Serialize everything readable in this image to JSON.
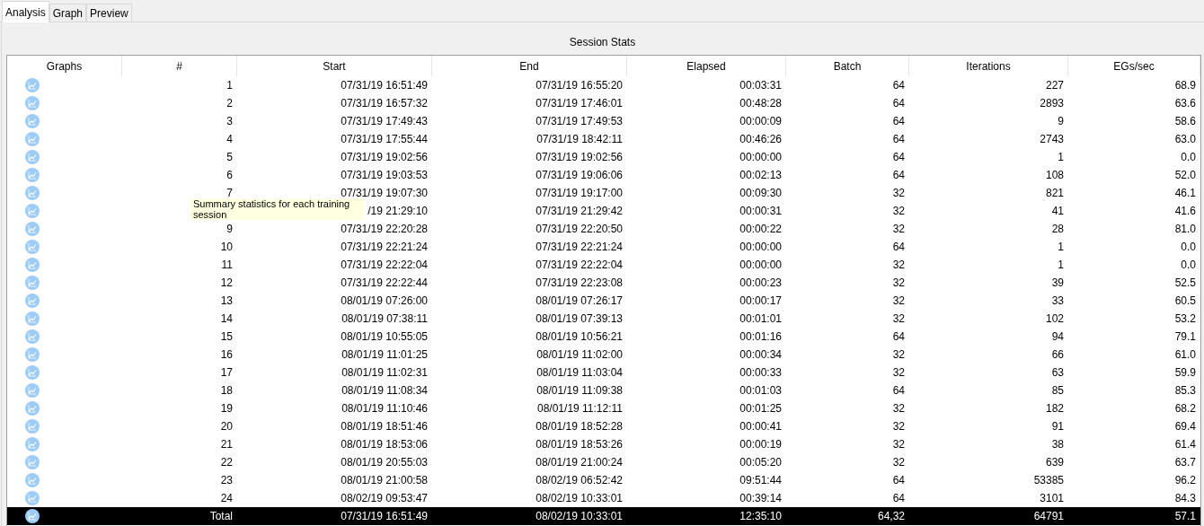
{
  "tabs": [
    {
      "label": "Analysis",
      "selected": true
    },
    {
      "label": "Graph",
      "selected": false
    },
    {
      "label": "Preview",
      "selected": false
    }
  ],
  "panel_title": "Session Stats",
  "columns": [
    "Graphs",
    "#",
    "Start",
    "End",
    "Elapsed",
    "Batch",
    "Iterations",
    "EGs/sec"
  ],
  "rows": [
    {
      "num": "1",
      "start": "07/31/19 16:51:49",
      "end": "07/31/19 16:55:20",
      "elapsed": "00:03:31",
      "batch": "64",
      "iterations": "227",
      "egs": "68.9",
      "selected": false
    },
    {
      "num": "2",
      "start": "07/31/19 16:57:32",
      "end": "07/31/19 17:46:01",
      "elapsed": "00:48:28",
      "batch": "64",
      "iterations": "2893",
      "egs": "63.6",
      "selected": false
    },
    {
      "num": "3",
      "start": "07/31/19 17:49:43",
      "end": "07/31/19 17:49:53",
      "elapsed": "00:00:09",
      "batch": "64",
      "iterations": "9",
      "egs": "58.6",
      "selected": false
    },
    {
      "num": "4",
      "start": "07/31/19 17:55:44",
      "end": "07/31/19 18:42:11",
      "elapsed": "00:46:26",
      "batch": "64",
      "iterations": "2743",
      "egs": "63.0",
      "selected": false
    },
    {
      "num": "5",
      "start": "07/31/19 19:02:56",
      "end": "07/31/19 19:02:56",
      "elapsed": "00:00:00",
      "batch": "64",
      "iterations": "1",
      "egs": "0.0",
      "selected": false
    },
    {
      "num": "6",
      "start": "07/31/19 19:03:53",
      "end": "07/31/19 19:06:06",
      "elapsed": "00:02:13",
      "batch": "64",
      "iterations": "108",
      "egs": "52.0",
      "selected": false
    },
    {
      "num": "7",
      "start": "07/31/19 19:07:30",
      "end": "07/31/19 19:17:00",
      "elapsed": "00:09:30",
      "batch": "32",
      "iterations": "821",
      "egs": "46.1",
      "selected": false
    },
    {
      "start": "/19 21:29:10",
      "end": "07/31/19 21:29:42",
      "elapsed": "00:00:31",
      "batch": "32",
      "iterations": "41",
      "egs": "41.6",
      "selected": false
    },
    {
      "num": "9",
      "start": "07/31/19 22:20:28",
      "end": "07/31/19 22:20:50",
      "elapsed": "00:00:22",
      "batch": "32",
      "iterations": "28",
      "egs": "81.0",
      "selected": false
    },
    {
      "num": "10",
      "start": "07/31/19 22:21:24",
      "end": "07/31/19 22:21:24",
      "elapsed": "00:00:00",
      "batch": "64",
      "iterations": "1",
      "egs": "0.0",
      "selected": false
    },
    {
      "num": "11",
      "start": "07/31/19 22:22:04",
      "end": "07/31/19 22:22:04",
      "elapsed": "00:00:00",
      "batch": "32",
      "iterations": "1",
      "egs": "0.0",
      "selected": false
    },
    {
      "num": "12",
      "start": "07/31/19 22:22:44",
      "end": "07/31/19 22:23:08",
      "elapsed": "00:00:23",
      "batch": "32",
      "iterations": "39",
      "egs": "52.5",
      "selected": false
    },
    {
      "num": "13",
      "start": "08/01/19 07:26:00",
      "end": "08/01/19 07:26:17",
      "elapsed": "00:00:17",
      "batch": "32",
      "iterations": "33",
      "egs": "60.5",
      "selected": false
    },
    {
      "num": "14",
      "start": "08/01/19 07:38:11",
      "end": "08/01/19 07:39:13",
      "elapsed": "00:01:01",
      "batch": "32",
      "iterations": "102",
      "egs": "53.2",
      "selected": false
    },
    {
      "num": "15",
      "start": "08/01/19 10:55:05",
      "end": "08/01/19 10:56:21",
      "elapsed": "00:01:16",
      "batch": "64",
      "iterations": "94",
      "egs": "79.1",
      "selected": false
    },
    {
      "num": "16",
      "start": "08/01/19 11:01:25",
      "end": "08/01/19 11:02:00",
      "elapsed": "00:00:34",
      "batch": "32",
      "iterations": "66",
      "egs": "61.0",
      "selected": false
    },
    {
      "num": "17",
      "start": "08/01/19 11:02:31",
      "end": "08/01/19 11:03:04",
      "elapsed": "00:00:33",
      "batch": "32",
      "iterations": "63",
      "egs": "59.9",
      "selected": false
    },
    {
      "num": "18",
      "start": "08/01/19 11:08:34",
      "end": "08/01/19 11:09:38",
      "elapsed": "00:01:03",
      "batch": "64",
      "iterations": "85",
      "egs": "85.3",
      "selected": false
    },
    {
      "num": "19",
      "start": "08/01/19 11:10:46",
      "end": "08/01/19 11:12:11",
      "elapsed": "00:01:25",
      "batch": "32",
      "iterations": "182",
      "egs": "68.2",
      "selected": false
    },
    {
      "num": "20",
      "start": "08/01/19 18:51:46",
      "end": "08/01/19 18:52:28",
      "elapsed": "00:00:41",
      "batch": "32",
      "iterations": "91",
      "egs": "69.4",
      "selected": false
    },
    {
      "num": "21",
      "start": "08/01/19 18:53:06",
      "end": "08/01/19 18:53:26",
      "elapsed": "00:00:19",
      "batch": "32",
      "iterations": "38",
      "egs": "61.4",
      "selected": false
    },
    {
      "num": "22",
      "start": "08/01/19 20:55:03",
      "end": "08/01/19 21:00:24",
      "elapsed": "00:05:20",
      "batch": "32",
      "iterations": "639",
      "egs": "63.7",
      "selected": false
    },
    {
      "num": "23",
      "start": "08/01/19 21:00:58",
      "end": "08/02/19 06:52:42",
      "elapsed": "09:51:44",
      "batch": "64",
      "iterations": "53385",
      "egs": "96.2",
      "selected": false
    },
    {
      "num": "24",
      "start": "08/02/19 09:53:47",
      "end": "08/02/19 10:33:01",
      "elapsed": "00:39:14",
      "batch": "64",
      "iterations": "3101",
      "egs": "84.3",
      "selected": false
    },
    {
      "num": "Total",
      "start": "07/31/19 16:51:49",
      "end": "08/02/19 10:33:01",
      "elapsed": "12:35:10",
      "batch": "64,32",
      "iterations": "64791",
      "egs": "57.1",
      "selected": true
    }
  ],
  "tooltip": "Summary statistics for each training session"
}
